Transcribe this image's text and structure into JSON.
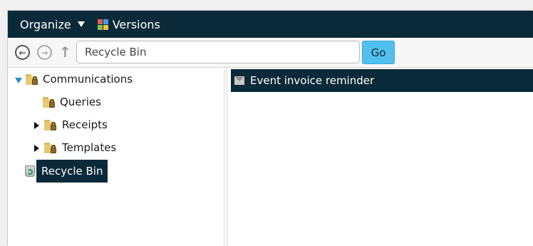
{
  "toolbar": {
    "organize_label": "Organize",
    "versions_label": "Versions",
    "versions_icon_colors": [
      "#e55b52",
      "#4f9be0",
      "#7ac552",
      "#f2c141"
    ]
  },
  "nav": {
    "back_icon": "back-arrow-icon",
    "forward_icon": "forward-arrow-icon",
    "up_icon": "up-arrow-icon",
    "path_value": "Recycle Bin",
    "go_label": "Go"
  },
  "tree": {
    "items": [
      {
        "label": "Communications",
        "expanded": true,
        "icon": "locked-folder-icon"
      },
      {
        "label": "Queries",
        "icon": "locked-folder-icon"
      },
      {
        "label": "Receipts",
        "expanded": false,
        "icon": "locked-folder-icon"
      },
      {
        "label": "Templates",
        "expanded": false,
        "icon": "locked-folder-icon"
      },
      {
        "label": "Recycle Bin",
        "selected": true,
        "icon": "recycle-bin-icon"
      }
    ]
  },
  "list": {
    "items": [
      {
        "label": "Event invoice reminder",
        "icon": "email-icon",
        "selected": true
      }
    ]
  },
  "colors": {
    "header_bg": "#0b2a39",
    "accent_button": "#52c0ee",
    "expander_blue": "#2d8fc4"
  }
}
